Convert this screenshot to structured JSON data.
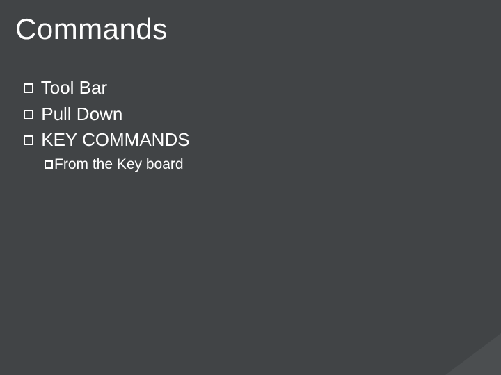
{
  "title": "Commands",
  "items_l1": [
    {
      "label": " Tool Bar"
    },
    {
      "label": " Pull Down"
    },
    {
      "label": " KEY COMMANDS"
    }
  ],
  "items_l2": [
    {
      "label": "From the Key board"
    }
  ]
}
